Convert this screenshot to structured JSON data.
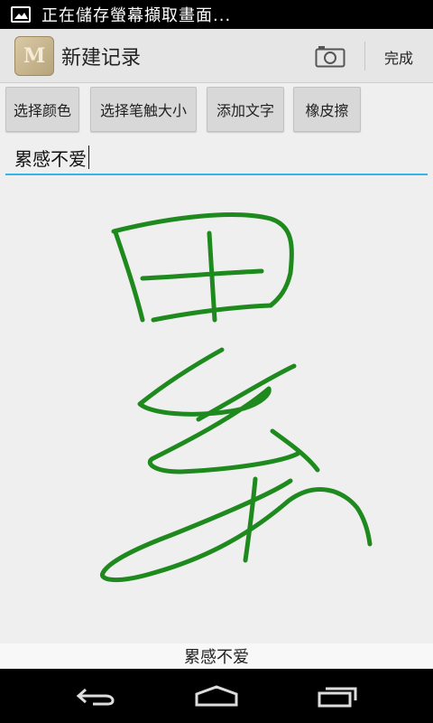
{
  "status_bar": {
    "notification_text": "正在儲存螢幕擷取畫面..."
  },
  "action_bar": {
    "title": "新建记录",
    "done_label": "完成"
  },
  "toolbar": {
    "buttons": [
      "选择颜色",
      "选择笔触大小",
      "添加文字",
      "橡皮擦"
    ]
  },
  "input": {
    "value": "累感不爱"
  },
  "caption": "累感不爱",
  "colors": {
    "stroke": "#1e8a1e",
    "accent": "#33b5e5"
  },
  "icons": [
    "image-notification-icon",
    "app-notebook-icon",
    "camera-icon",
    "back-icon",
    "home-icon",
    "recent-apps-icon"
  ]
}
